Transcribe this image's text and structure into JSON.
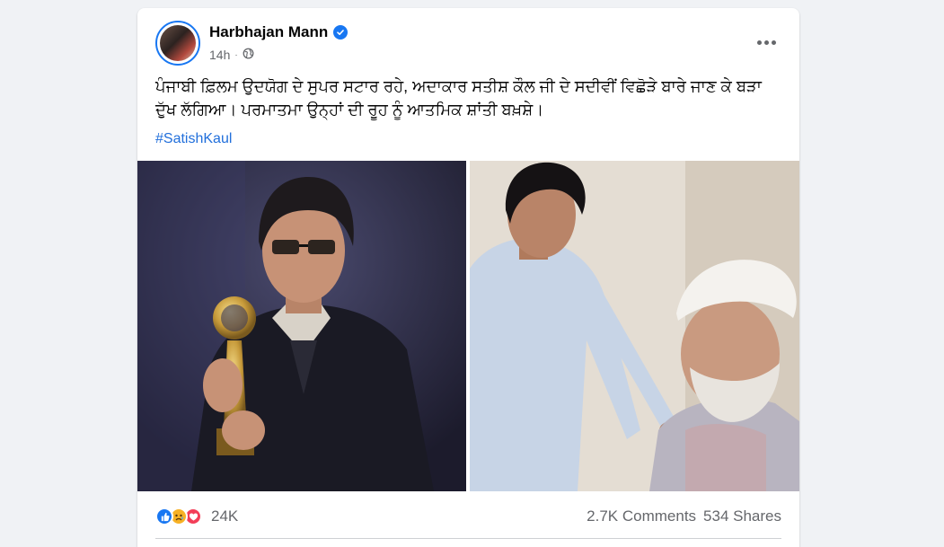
{
  "post": {
    "author": "Harbhajan Mann",
    "time": "14h",
    "text": "ਪੰਜਾਬੀ ਫ਼ਿਲਮ ਉਦਯੋਗ ਦੇ ਸੁਪਰ ਸਟਾਰ ਰਹੇ, ਅਦਾਕਾਰ ਸਤੀਸ਼ ਕੌਲ ਜੀ ਦੇ ਸਦੀਵੀਂ ਵਿਛੋੜੇ ਬਾਰੇ ਜਾਣ ਕੇ ਬੜਾ ਦੁੱਖ ਲੱਗਿਆ। ਪਰਮਾਤਮਾ ਉਨ੍ਹਾਂ ਦੀ ਰੂਹ ਨੂੰ ਆਤਮਿਕ ਸ਼ਾਂਤੀ ਬਖ਼ਸ਼ੇ।",
    "hashtag": "#SatishKaul"
  },
  "stats": {
    "reactions_count": "24K",
    "comments": "2.7K Comments",
    "shares": "534 Shares"
  },
  "icons": {
    "verified": "verified-badge-icon",
    "privacy": "globe-icon",
    "more": "more-options-icon",
    "reactions": [
      "like-reaction-icon",
      "sad-reaction-icon",
      "love-reaction-icon"
    ]
  },
  "colors": {
    "accent": "#1877f2",
    "hashtag": "#216fdb",
    "love": "#f33e58",
    "sad": "#f7b125",
    "muted_text": "#65676b",
    "background": "#f0f2f5"
  }
}
